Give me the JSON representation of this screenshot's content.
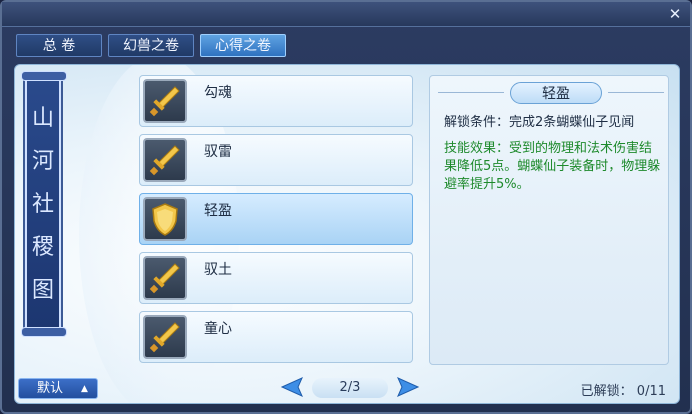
{
  "window": {
    "close_label": "✕"
  },
  "tabs": [
    {
      "label": "总  卷"
    },
    {
      "label": "幻兽之卷"
    },
    {
      "label": "心得之卷"
    }
  ],
  "scroll_banner": {
    "text": "山河社稷图"
  },
  "skills": [
    {
      "name": "勾魂",
      "icon": "sword-icon"
    },
    {
      "name": "驭雷",
      "icon": "sword-icon"
    },
    {
      "name": "轻盈",
      "icon": "shield-icon",
      "selected": true
    },
    {
      "name": "驭土",
      "icon": "sword-icon"
    },
    {
      "name": "童心",
      "icon": "sword-icon"
    }
  ],
  "detail": {
    "title": "轻盈",
    "unlock_condition": "解锁条件：完成2条蝴蝶仙子见闻",
    "effect": "技能效果：受到的物理和法术伤害结果降低5点。蝴蝶仙子装备时，物理躲避率提升5%。"
  },
  "bottom": {
    "default_label": "默认",
    "page": "2/3",
    "unlocked": "已解锁：  0/11"
  },
  "colors": {
    "accent": "#2f72c0",
    "effect_text": "#1e8a2c"
  }
}
